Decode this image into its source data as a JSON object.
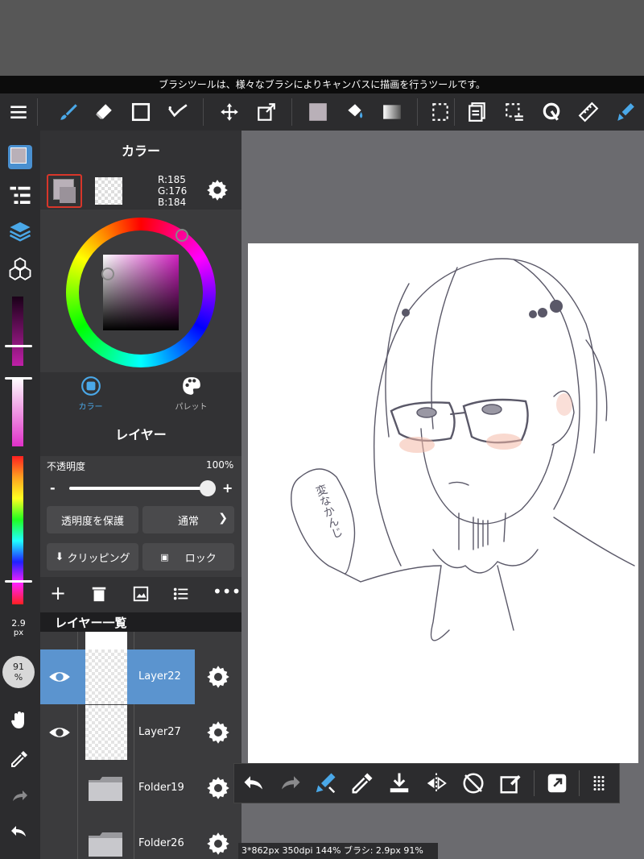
{
  "hint_text": "ブラシツールは、様々なブラシによりキャンバスに描画を行うツールです。",
  "toolbar": {
    "items": [
      "menu-icon",
      "brush-icon",
      "eraser-icon",
      "rectangle-icon",
      "select-check-icon",
      "move-icon",
      "transform-icon",
      "fill-color-icon",
      "bucket-icon",
      "gradient-icon",
      "select-dotted-icon",
      "copy-layer-icon",
      "select-menu-icon",
      "lasso-icon",
      "ruler-icon",
      "brush-blue-icon"
    ]
  },
  "color_panel": {
    "title": "カラー",
    "r": "R:185",
    "g": "G:176",
    "b": "B:184",
    "main_color": "#b9b0b8",
    "tab_color": "カラー",
    "tab_palette": "パレット"
  },
  "layer_panel": {
    "title": "レイヤー",
    "opacity_label": "不透明度",
    "opacity_value": "100%",
    "opacity_fraction": 1.0,
    "minus": "-",
    "plus": "+",
    "protect_alpha": "透明度を保護",
    "blend_mode": "通常",
    "clipping": "クリッピング",
    "lock": "ロック",
    "list_title": "レイヤー一覧",
    "layers": [
      {
        "name": "Layer22",
        "selected": true,
        "visible": true
      },
      {
        "name": "Layer27",
        "selected": false,
        "visible": true
      },
      {
        "name": "Folder19",
        "selected": false,
        "visible": false
      },
      {
        "name": "Folder26",
        "selected": false,
        "visible": false
      }
    ]
  },
  "left_sidebar": {
    "brush_size": "2.9",
    "brush_size_unit": "px",
    "opacity": "91",
    "opacity_unit": "%"
  },
  "canvas_text": "変なかんじ",
  "info_bar": "3*862px 350dpi 144% ブラシ: 2.9px 91%"
}
